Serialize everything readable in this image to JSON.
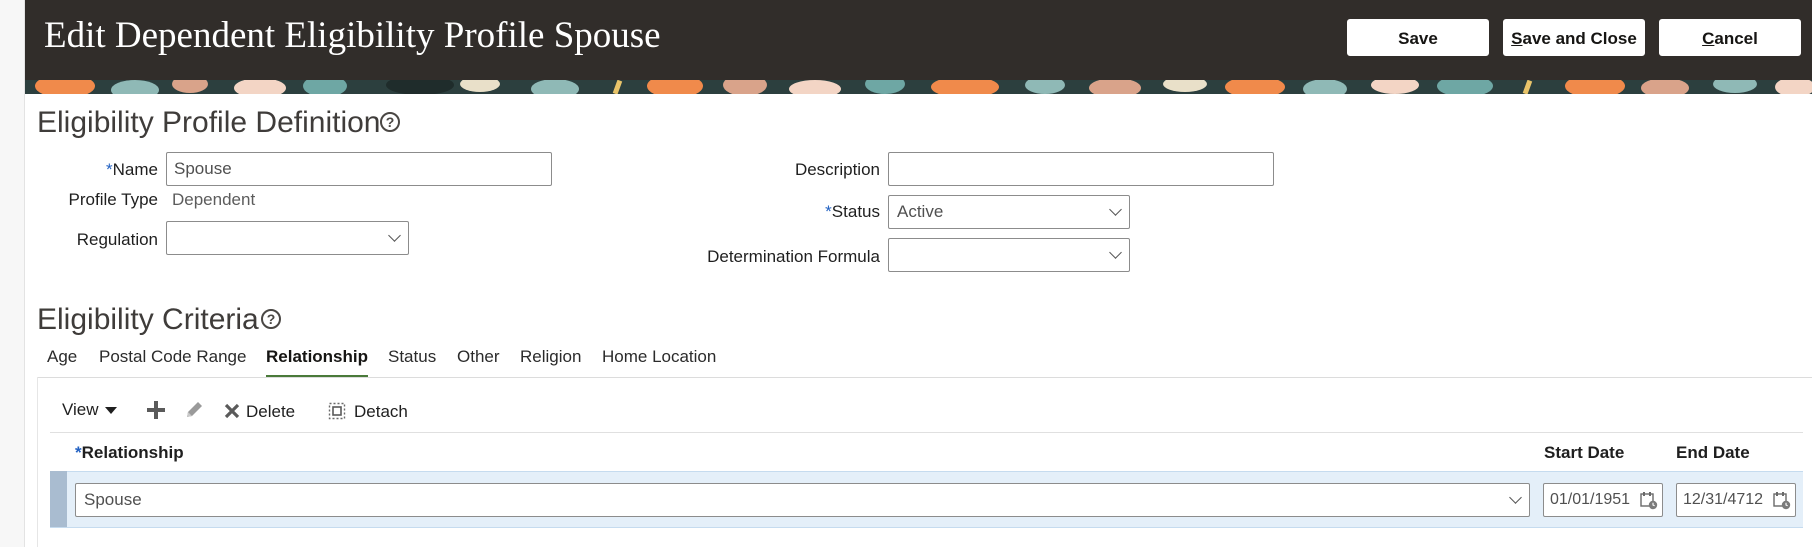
{
  "header": {
    "title": "Edit Dependent Eligibility Profile Spouse",
    "buttons": {
      "save": "Save",
      "save_close_first": "S",
      "save_close_rest": "ave and Close",
      "cancel_first": "C",
      "cancel_rest": "ancel"
    },
    "bg_color": "#312d2a"
  },
  "definition": {
    "section_title": "Eligibility Profile Definition",
    "required_marker": "*",
    "name": {
      "label": "Name",
      "value": "Spouse"
    },
    "profile_type": {
      "label": "Profile Type",
      "value": "Dependent"
    },
    "regulation": {
      "label": "Regulation",
      "value": ""
    },
    "description": {
      "label": "Description",
      "value": ""
    },
    "status": {
      "label": "Status",
      "value": "Active"
    },
    "determination_formula": {
      "label": "Determination Formula",
      "value": ""
    }
  },
  "criteria": {
    "section_title": "Eligibility Criteria",
    "tabs": [
      "Age",
      "Postal Code Range",
      "Relationship",
      "Status",
      "Other",
      "Religion",
      "Home Location"
    ],
    "active_tab": "Relationship",
    "toolbar": {
      "view": "View",
      "delete": "Delete",
      "detach": "Detach"
    },
    "table": {
      "columns": {
        "relationship": "Relationship",
        "start_date": "Start Date",
        "end_date": "End Date"
      },
      "rows": [
        {
          "relationship": "Spouse",
          "start_date": "01/01/1951",
          "end_date": "12/31/4712"
        }
      ]
    }
  },
  "icons": {
    "help": "help-circle-icon",
    "add": "plus-icon",
    "edit": "pencil-icon",
    "delete": "x-icon",
    "detach": "detach-icon",
    "calendar": "calendar-icon"
  },
  "colors": {
    "required": "#2261c2",
    "active_tab_underline": "#4a7a3a",
    "selected_row": "#e4eff9"
  }
}
